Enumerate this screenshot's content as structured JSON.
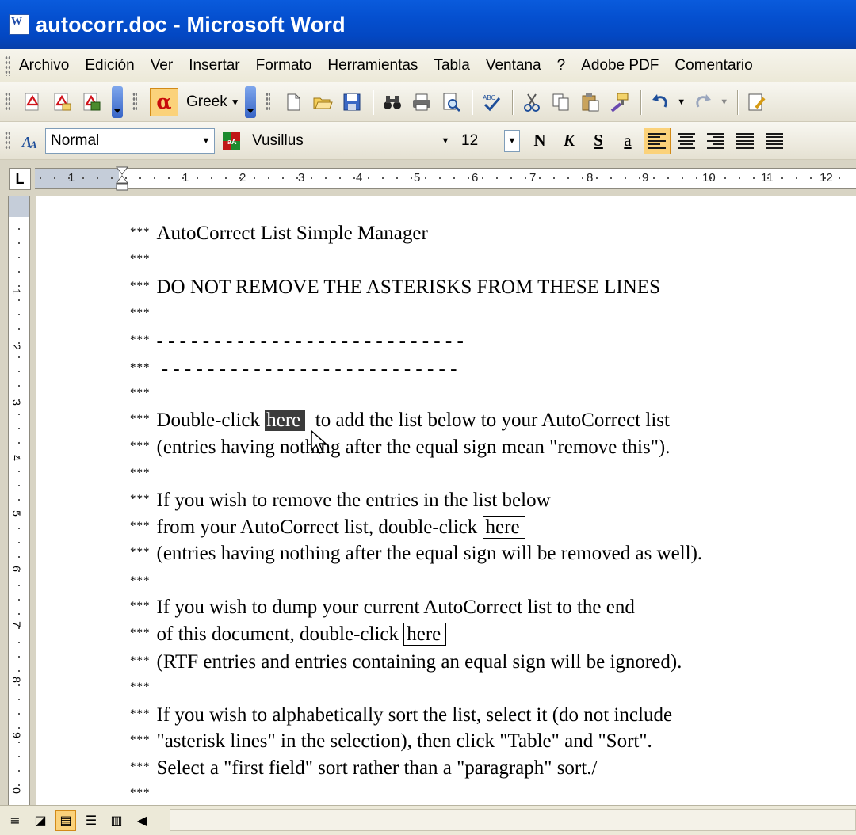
{
  "window": {
    "title": "autocorr.doc - Microsoft Word"
  },
  "menu": [
    "Archivo",
    "Edición",
    "Ver",
    "Insertar",
    "Formato",
    "Herramientas",
    "Tabla",
    "Ventana",
    "?",
    "Adobe PDF",
    "Comentario"
  ],
  "toolbar": {
    "keyboard_language": "Greek",
    "style": "Normal",
    "font": "Vusillus",
    "size": "12",
    "bold_label": "N",
    "italic_label": "K",
    "underline_label": "S",
    "underline_char": "a"
  },
  "ruler": {
    "tab_label": "L",
    "numbers": [
      "1",
      "1",
      "2",
      "3",
      "4",
      "5",
      "6",
      "7",
      "8",
      "9",
      "10",
      "11",
      "12"
    ]
  },
  "vruler": {
    "numbers": [
      "1",
      "2",
      "3",
      "4",
      "5",
      "6",
      "7",
      "8",
      "9",
      "0"
    ]
  },
  "document": {
    "lines": [
      {
        "ast": "***",
        "text": "AutoCorrect List Simple Manager"
      },
      {
        "ast": "***",
        "text": ""
      },
      {
        "ast": "***",
        "text": "DO NOT REMOVE THE ASTERISKS FROM THESE LINES"
      },
      {
        "ast": "***",
        "text": ""
      },
      {
        "ast": "***",
        "text": "- - - - - - - - - - - - - - - - - - - - - - - - - - -"
      },
      {
        "ast": "***",
        "text": " - - - - - - - - - - - - - - - - - - - - - - - - - -"
      },
      {
        "ast": "***",
        "text": ""
      },
      {
        "ast": "***",
        "pre": "Double-click ",
        "link": "here",
        "post": "  to add the list below to your AutoCorrect list",
        "link_style": "hl"
      },
      {
        "ast": "***",
        "text": "(entries having nothing after the equal sign mean \"remove this\")."
      },
      {
        "ast": "***",
        "text": ""
      },
      {
        "ast": "***",
        "text": "If you wish to remove the entries in the list below"
      },
      {
        "ast": "***",
        "pre": "from your AutoCorrect list, double-click ",
        "link": "here",
        "post": "",
        "link_style": "boxed"
      },
      {
        "ast": "***",
        "text": "(entries having nothing after the equal sign will be removed as well)."
      },
      {
        "ast": "***",
        "text": ""
      },
      {
        "ast": "***",
        "text": "If you wish to dump your current AutoCorrect list to the end"
      },
      {
        "ast": "***",
        "pre": "of this document, double-click ",
        "link": "here",
        "post": "",
        "link_style": "boxed"
      },
      {
        "ast": "***",
        "text": "(RTF entries and entries containing an equal sign will be ignored)."
      },
      {
        "ast": "***",
        "text": ""
      },
      {
        "ast": "***",
        "text": "If you wish to alphabetically sort the list, select it (do not include"
      },
      {
        "ast": "***",
        "text": "\"asterisk lines\" in the selection), then click \"Table\" and \"Sort\"."
      },
      {
        "ast": "***",
        "text": "Select a \"first field\" sort rather than a \"paragraph\" sort./"
      },
      {
        "ast": "***",
        "text": ""
      }
    ]
  },
  "colors": {
    "titlebar": "#0550d0",
    "highlight": "#3b3b3b",
    "active_button": "#fbd27a"
  }
}
